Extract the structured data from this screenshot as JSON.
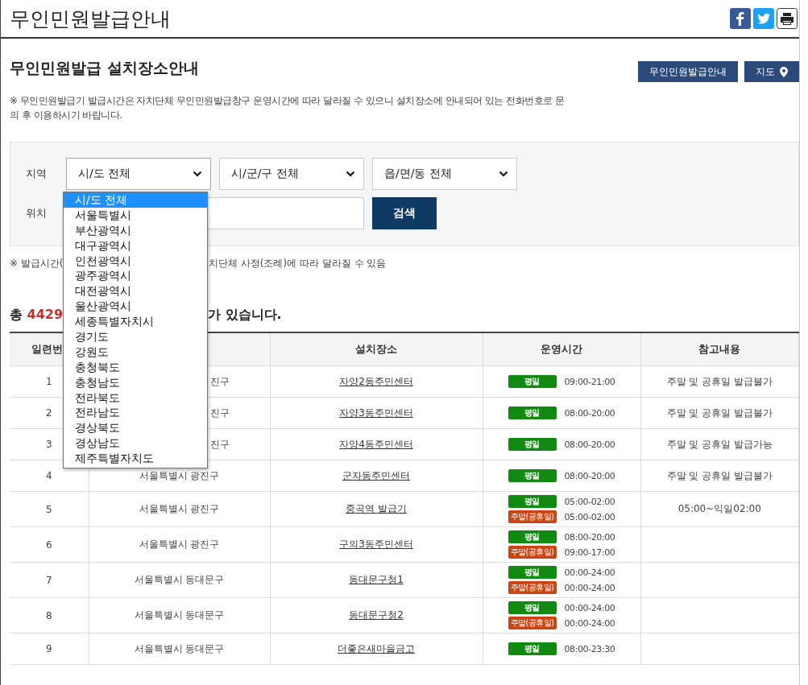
{
  "page_title": "무인민원발급안내",
  "section_title": "무인민원발급 설치장소안내",
  "header_buttons": [
    {
      "label": "무인민원발급안내",
      "kind": "text"
    },
    {
      "label": "지도",
      "kind": "map"
    }
  ],
  "notice": "※ 무인민원발급기 발급시간은 자치단체 무인민원발급창구 운영시간에 따라 달라질 수 있으니 설치장소에 안내되어 있는 전화번호로 문의 후 이용하시기 바랍니다.",
  "search": {
    "region_label": "지역",
    "selects": [
      {
        "value": "시/도 전체",
        "expanded": true
      },
      {
        "value": "시/군/구 전체",
        "expanded": false
      },
      {
        "value": "읍/면/동 전체",
        "expanded": false
      }
    ],
    "location_label": "위치",
    "button": "검색"
  },
  "dropdown": [
    {
      "label": "시/도 전체",
      "selected": true
    },
    {
      "label": "서울특별시",
      "selected": false
    },
    {
      "label": "부산광역시",
      "selected": false
    },
    {
      "label": "대구광역시",
      "selected": false
    },
    {
      "label": "인천광역시",
      "selected": false
    },
    {
      "label": "광주광역시",
      "selected": false
    },
    {
      "label": "대전광역시",
      "selected": false
    },
    {
      "label": "울산광역시",
      "selected": false
    },
    {
      "label": "세종특별자치시",
      "selected": false
    },
    {
      "label": "경기도",
      "selected": false
    },
    {
      "label": "강원도",
      "selected": false
    },
    {
      "label": "충청북도",
      "selected": false
    },
    {
      "label": "충청남도",
      "selected": false
    },
    {
      "label": "전라북도",
      "selected": false
    },
    {
      "label": "전라남도",
      "selected": false
    },
    {
      "label": "경상북도",
      "selected": false
    },
    {
      "label": "경상남도",
      "selected": false
    },
    {
      "label": "제주특별자치도",
      "selected": false
    }
  ],
  "note": {
    "left": "※ 발급시간(",
    "right": "치단체 사정(조례)에 따라 달라질 수 있음"
  },
  "total": {
    "prefix": "총",
    "count": "4429",
    "suffix": "가 있습니다."
  },
  "table": {
    "columns": [
      "일련번",
      "설치장소",
      "운영시간",
      "참고내용"
    ],
    "rows": [
      {
        "number": "1",
        "region": "진구",
        "place": "자양2동주민센터",
        "times": [
          {
            "kind": "weekday",
            "label": "평일",
            "time": "09:00-21:00"
          }
        ],
        "note": "주말 및 공휴일 발급불가"
      },
      {
        "number": "2",
        "region": "진구",
        "place": "자양3동주민센터",
        "times": [
          {
            "kind": "weekday",
            "label": "평일",
            "time": "08:00-20:00"
          }
        ],
        "note": "주말 및 공휴일 발급불가"
      },
      {
        "number": "3",
        "region": "진구",
        "place": "자양4동주민센터",
        "times": [
          {
            "kind": "weekday",
            "label": "평일",
            "time": "08:00-20:00"
          }
        ],
        "note": "주말 및 공휴일 발급가능"
      },
      {
        "number": "4",
        "region": "서울특별시 광진구",
        "place": "군자동주민센터",
        "times": [
          {
            "kind": "weekday",
            "label": "평일",
            "time": "08:00-20:00"
          }
        ],
        "note": "주말 및 공휴일 발급불가"
      },
      {
        "number": "5",
        "region": "서울특별시 광진구",
        "place": "중곡역 발급기",
        "times": [
          {
            "kind": "weekday",
            "label": "평일",
            "time": "05:00-02:00"
          },
          {
            "kind": "weekend",
            "label": "주말(공휴일)",
            "time": "05:00-02:00"
          }
        ],
        "note": "05:00~익일02:00"
      },
      {
        "number": "6",
        "region": "서울특별시 광진구",
        "place": "구의3동주민센터",
        "times": [
          {
            "kind": "weekday",
            "label": "평일",
            "time": "08:00-20:00"
          },
          {
            "kind": "weekend",
            "label": "주말(공휴일)",
            "time": "09:00-17:00"
          }
        ]
      },
      {
        "number": "7",
        "region": "서울특별시 동대문구",
        "place": "동대문구청1",
        "times": [
          {
            "kind": "weekday",
            "label": "평일",
            "time": "00:00-24:00"
          },
          {
            "kind": "weekend",
            "label": "주말(공휴일)",
            "time": "00:00-24:00"
          }
        ]
      },
      {
        "number": "8",
        "region": "서울특별시 동대문구",
        "place": "동대문구청2",
        "times": [
          {
            "kind": "weekday",
            "label": "평일",
            "time": "00:00-24:00"
          },
          {
            "kind": "weekend",
            "label": "주말(공휴일)",
            "time": "00:00-24:00"
          }
        ]
      },
      {
        "number": "9",
        "region": "서울특별시 동대문구",
        "place": "더좋은새마을금고",
        "times": [
          {
            "kind": "weekday",
            "label": "평일",
            "time": "08:00-23:30"
          }
        ]
      }
    ]
  }
}
